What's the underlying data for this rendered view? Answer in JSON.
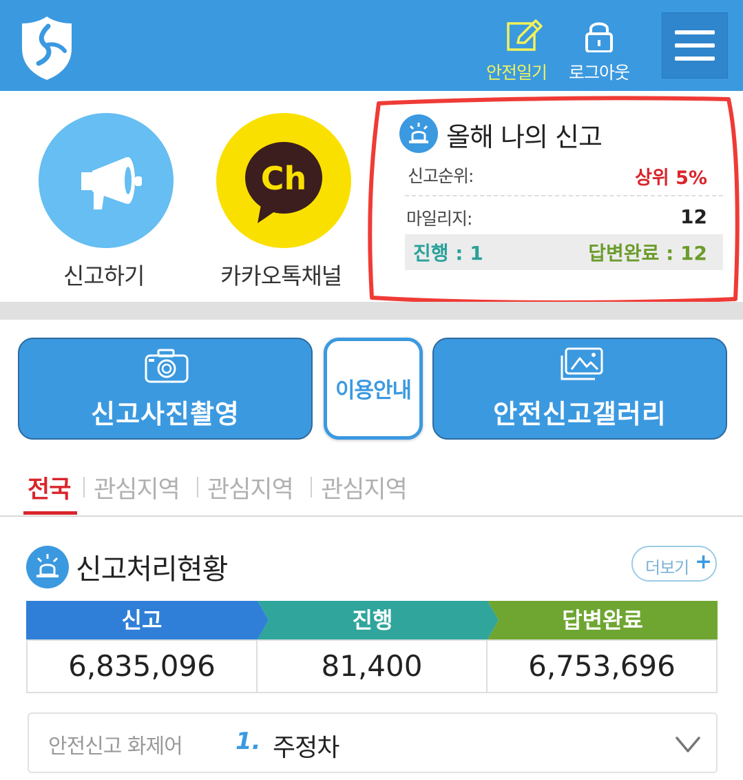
{
  "header": {
    "logo_icon": "shield-logo-icon",
    "diary_label": "안전일기",
    "logout_label": "로그아웃",
    "menu_icon": "hamburger-menu-icon",
    "bg_color": "#3b99e0"
  },
  "quick": {
    "report_label": "신고하기",
    "kakao_label": "카카오톡채널",
    "kakao_logo_text": "Ch"
  },
  "my_report": {
    "title": "올해 나의 신고",
    "rank_label": "신고순위:",
    "rank_value": "상위 5%",
    "mileage_label": "마일리지:",
    "mileage_value": "12",
    "in_progress": "진행 : 1",
    "answered": "답변완료 : 12"
  },
  "actions": {
    "photo_label": "신고사진촬영",
    "guide_label": "이용안내",
    "gallery_label": "안전신고갤러리"
  },
  "tabs": [
    "전국",
    "관심지역",
    "관심지역",
    "관심지역"
  ],
  "status": {
    "title": "신고처리현황",
    "more_label": "더보기",
    "more_plus": "+",
    "columns": [
      {
        "label": "신고",
        "value": "6,835,096",
        "color": "#2f7fd8"
      },
      {
        "label": "진행",
        "value": "81,400",
        "color": "#2fa59c"
      },
      {
        "label": "답변완료",
        "value": "6,753,696",
        "color": "#6fa631"
      }
    ]
  },
  "hot_keyword": {
    "label": "안전신고 화제어",
    "rank": "1.",
    "keyword": "주정차"
  }
}
